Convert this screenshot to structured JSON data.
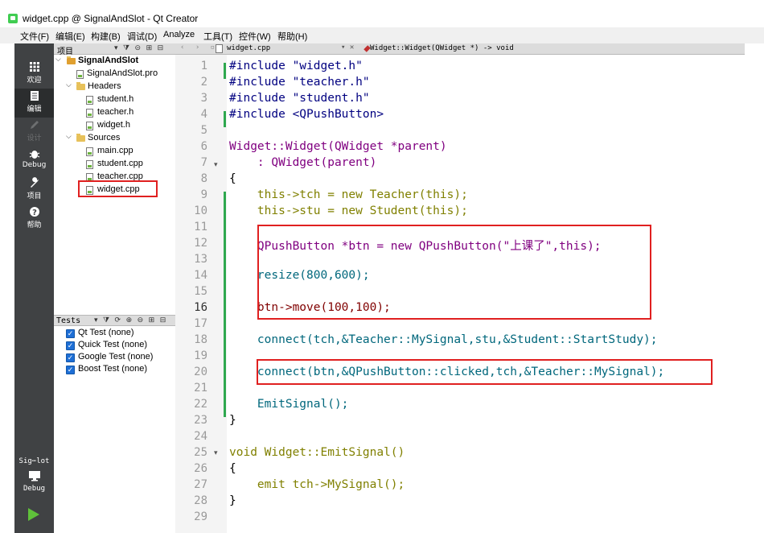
{
  "window": {
    "title": "widget.cpp @ SignalAndSlot - Qt Creator"
  },
  "menu": [
    "文件(F)",
    "编辑(E)",
    "构建(B)",
    "调试(D)",
    "Analyze",
    "工具(T)",
    "控件(W)",
    "帮助(H)"
  ],
  "modes": [
    {
      "label": "欢迎",
      "icon": "grid-icon"
    },
    {
      "label": "编辑",
      "icon": "edit-document-icon"
    },
    {
      "label": "设计",
      "icon": "pencil-icon"
    },
    {
      "label": "Debug",
      "icon": "bug-icon"
    },
    {
      "label": "项目",
      "icon": "wrench-icon"
    },
    {
      "label": "帮助",
      "icon": "help-icon"
    }
  ],
  "session": {
    "name": "Sig⋯lot",
    "kit": "Debug"
  },
  "project_pane": {
    "header": "项目",
    "tree": [
      {
        "label": "SignalAndSlot",
        "kind": "project"
      },
      {
        "label": "SignalAndSlot.pro",
        "kind": "pro"
      },
      {
        "label": "Headers",
        "kind": "folder"
      },
      {
        "label": "student.h",
        "kind": "file"
      },
      {
        "label": "teacher.h",
        "kind": "file"
      },
      {
        "label": "widget.h",
        "kind": "file"
      },
      {
        "label": "Sources",
        "kind": "folder"
      },
      {
        "label": "main.cpp",
        "kind": "file"
      },
      {
        "label": "student.cpp",
        "kind": "file"
      },
      {
        "label": "teacher.cpp",
        "kind": "file"
      },
      {
        "label": "widget.cpp",
        "kind": "file",
        "selected": true
      }
    ]
  },
  "tests_pane": {
    "header": "Tests",
    "items": [
      {
        "label": "Qt Test (none)",
        "checked": true
      },
      {
        "label": "Quick Test (none)",
        "checked": true
      },
      {
        "label": "Google Test (none)",
        "checked": true
      },
      {
        "label": "Boost Test (none)",
        "checked": true
      }
    ]
  },
  "editor": {
    "file_name": "widget.cpp",
    "symbol": "Widget::Widget(QWidget *) -> void",
    "current_line": 16,
    "line_numbers": [
      "1",
      "2",
      "3",
      "4",
      "5",
      "6",
      "7",
      "8",
      "9",
      "10",
      "11",
      "12",
      "13",
      "14",
      "15",
      "16",
      "17",
      "18",
      "19",
      "20",
      "21",
      "22",
      "23",
      "24",
      "25",
      "26",
      "27",
      "28",
      "29"
    ],
    "lines": {
      "l1": "#include \"widget.h\"",
      "l2": "#include \"teacher.h\"",
      "l3": "#include \"student.h\"",
      "l4": "#include <QPushButton>",
      "l6": "Widget::Widget(QWidget *parent)",
      "l7": "    : QWidget(parent)",
      "l8": "{",
      "l9": "    this->tch = new Teacher(this);",
      "l10": "    this->stu = new Student(this);",
      "l12": "    QPushButton *btn = new QPushButton(\"上课了\",this);",
      "l14": "    resize(800,600);",
      "l16": "    btn->move(100,100);",
      "l18": "    connect(tch,&Teacher::MySignal,stu,&Student::StartStudy);",
      "l20": "    connect(btn,&QPushButton::clicked,tch,&Teacher::MySignal);",
      "l22": "    EmitSignal();",
      "l23": "}",
      "l25": "void Widget::EmitSignal()",
      "l26": "{",
      "l27": "    emit tch->MySignal();",
      "l28": "}"
    }
  },
  "colors": {
    "mode_bar": "#404244",
    "highlight_box": "#e02020",
    "change_bar": "#2fa84f",
    "checkbox": "#1e6fd6"
  }
}
